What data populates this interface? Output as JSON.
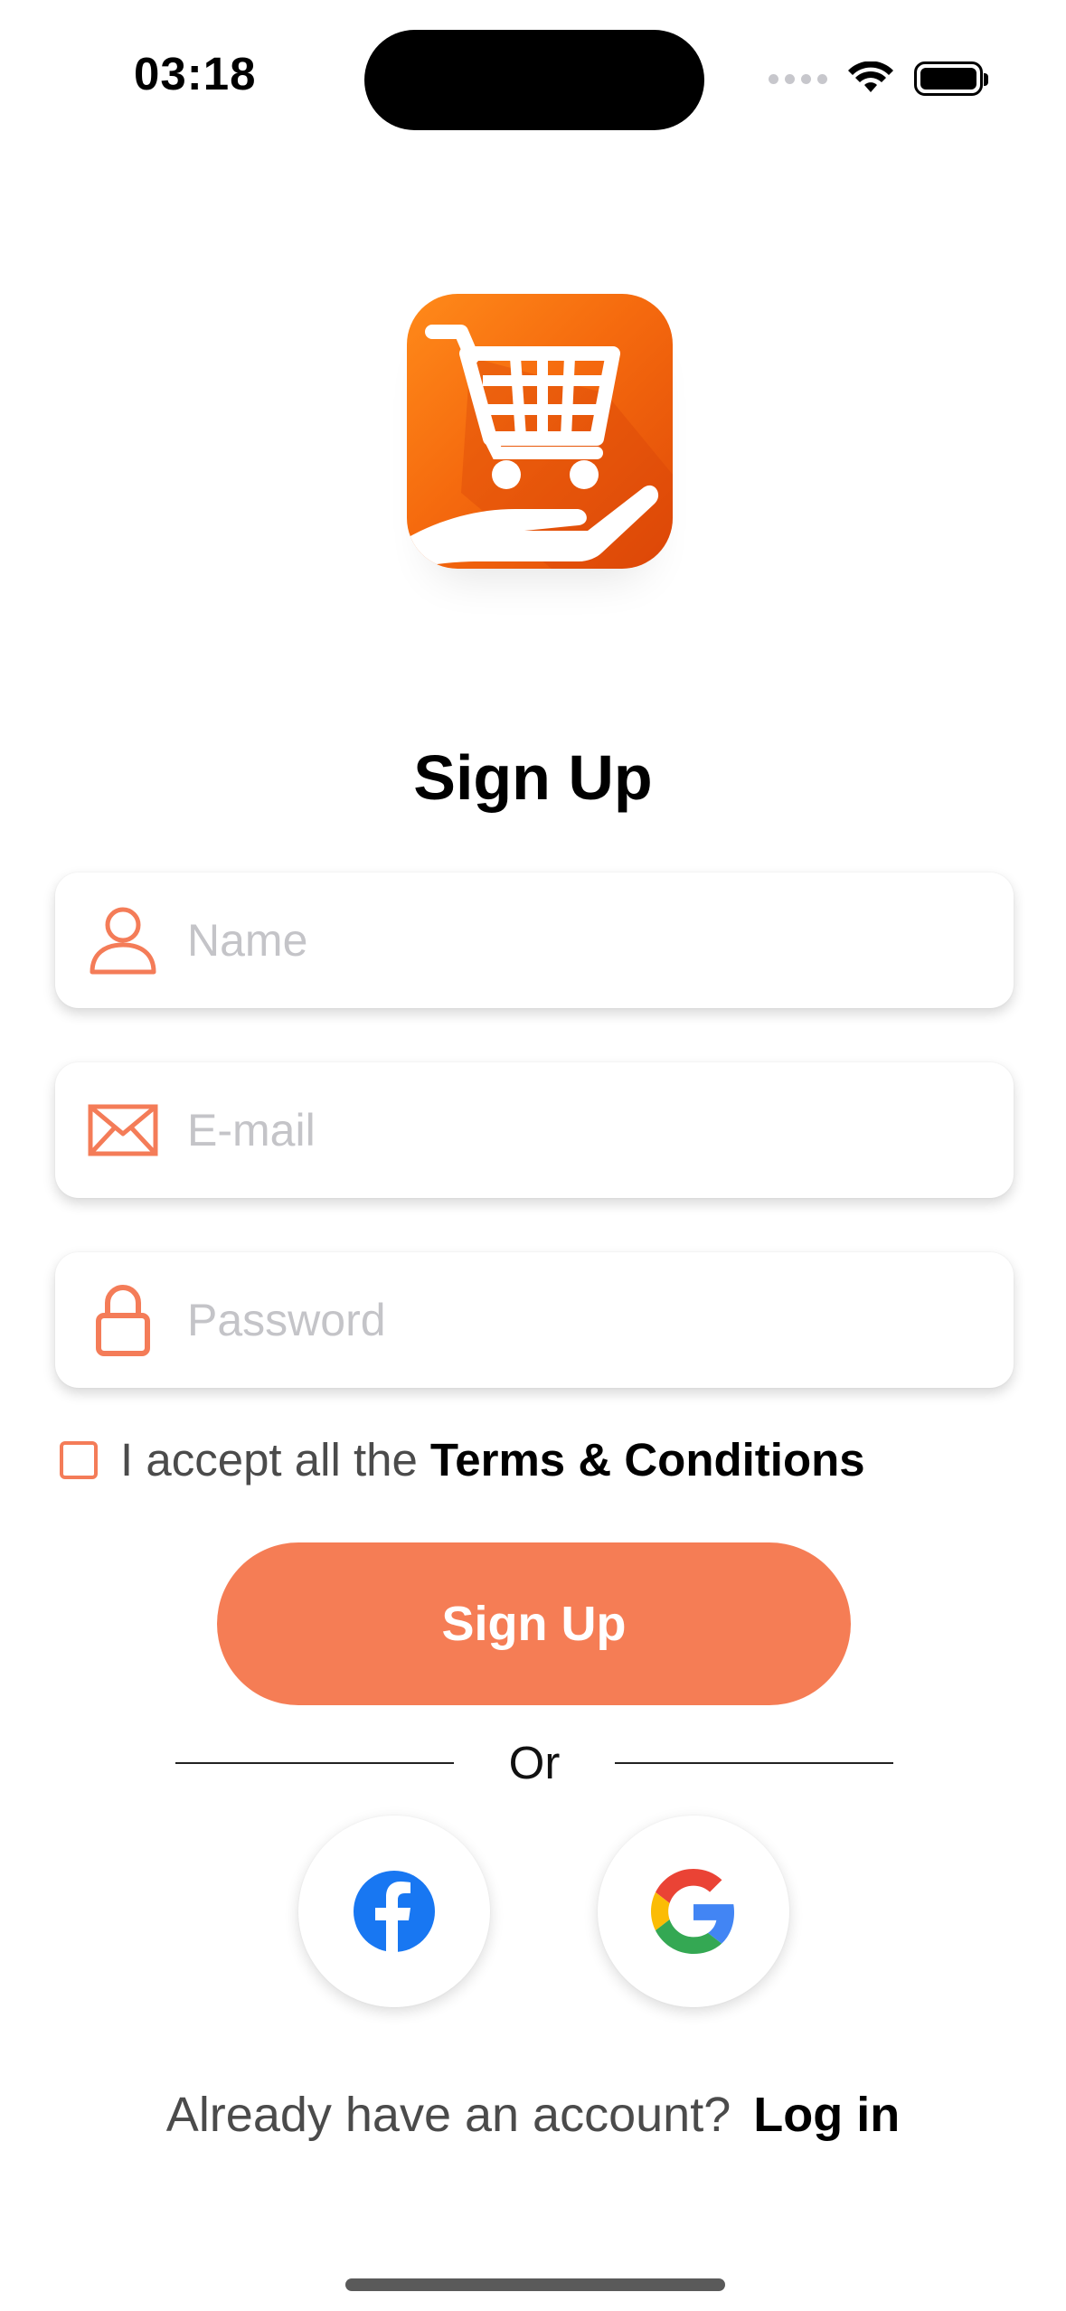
{
  "status_bar": {
    "time": "03:18"
  },
  "logo": {
    "icon": "shopping-cart-hand-icon",
    "color": "#f56a0e"
  },
  "title": "Sign Up",
  "form": {
    "name": {
      "placeholder": "Name",
      "value": "",
      "icon": "person-icon"
    },
    "email": {
      "placeholder": "E-mail",
      "value": "",
      "icon": "envelope-icon"
    },
    "password": {
      "placeholder": "Password",
      "value": "",
      "icon": "lock-icon"
    }
  },
  "terms": {
    "checked": false,
    "text": "I accept all the",
    "link": "Terms & Conditions"
  },
  "signup_button": "Sign Up",
  "divider": "Or",
  "social": {
    "facebook_icon": "facebook-icon",
    "google_icon": "google-icon"
  },
  "footer": {
    "prompt": "Already have an account?",
    "login": "Log in"
  },
  "colors": {
    "accent": "#f57d55",
    "icon": "#f47c58",
    "facebook": "#1877f2"
  }
}
